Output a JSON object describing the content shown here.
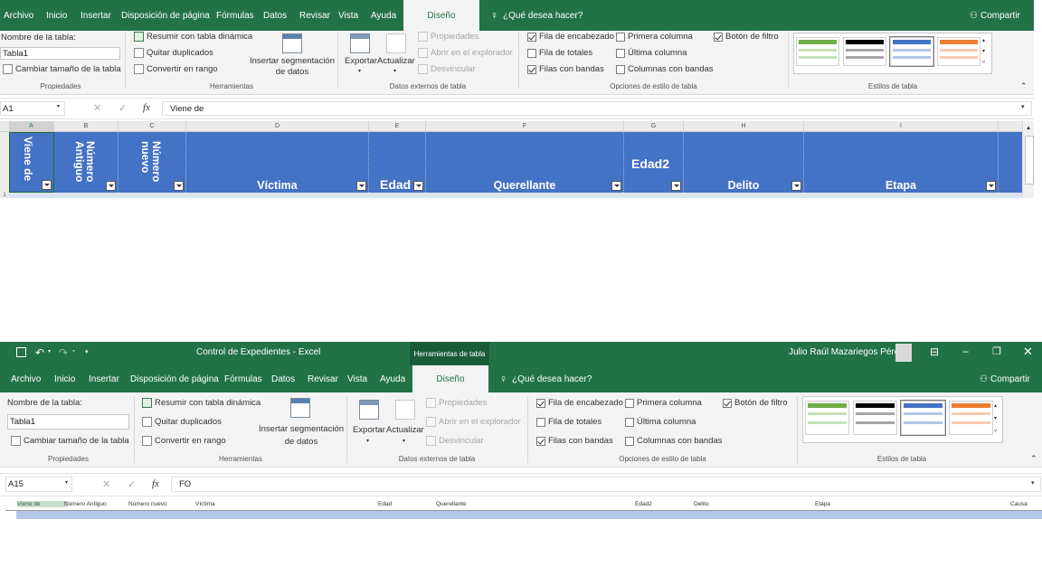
{
  "ribbon_tabs": [
    "Archivo",
    "Inicio",
    "Insertar",
    "Disposición de página",
    "Fórmulas",
    "Datos",
    "Revisar",
    "Vista",
    "Ayuda",
    "Diseño"
  ],
  "tell_me": "¿Qué desea hacer?",
  "share": "Compartir",
  "title_bar": {
    "title": "Control de Expedientes  -  Excel",
    "context_tab": "Herramientas de tabla",
    "user": "Julio Raúl Mazariegos Pérez"
  },
  "groups": {
    "properties": {
      "name_label": "Nombre de la tabla:",
      "table_name": "Tabla1",
      "resize": "Cambiar tamaño de la tabla",
      "label": "Propiedades"
    },
    "tools": {
      "pivot": "Resumir con tabla dinámica",
      "dedupe": "Quitar duplicados",
      "convert": "Convertir en rango",
      "slicer": "Insertar segmentación de datos",
      "label": "Herramientas"
    },
    "external": {
      "export": "Exportar",
      "refresh": "Actualizar",
      "properties": "Propiedades",
      "open_browser": "Abrir en el explorador",
      "unlink": "Desvincular",
      "label": "Datos externos de tabla"
    },
    "style_options": {
      "header_row": "Fila de encabezado",
      "total_row": "Fila de totales",
      "banded_rows": "Filas con bandas",
      "first_col": "Primera columna",
      "last_col": "Última columna",
      "banded_cols": "Columnas con bandas",
      "filter_btn": "Botón de filtro",
      "label": "Opciones de estilo de tabla"
    },
    "styles": {
      "label": "Estilos de tabla"
    }
  },
  "top_screenshot": {
    "cell_ref": "A1",
    "formula": "Viene de",
    "columns": [
      "A",
      "B",
      "C",
      "D",
      "E",
      "F",
      "G",
      "H",
      "I"
    ],
    "headers": [
      "Viene de",
      "Número Antiguo",
      "Número nuevo",
      "Víctima",
      "Edad",
      "Querellante",
      "Edad2",
      "Delito",
      "Etapa"
    ],
    "row_number": "1"
  },
  "bottom_screenshot": {
    "cell_ref": "A15",
    "formula": "FO",
    "headers": [
      "Viene de",
      "Número Antiguo",
      "Número nuevo",
      "Víctima",
      "Edad",
      "Querellante",
      "Edad2",
      "Delito",
      "Etapa",
      "Causa"
    ]
  },
  "icons": {
    "fx": "fx",
    "cancel": "✕",
    "confirm": "✓"
  },
  "colors": {
    "excel_green": "#217346",
    "table_blue": "#4472c4"
  }
}
